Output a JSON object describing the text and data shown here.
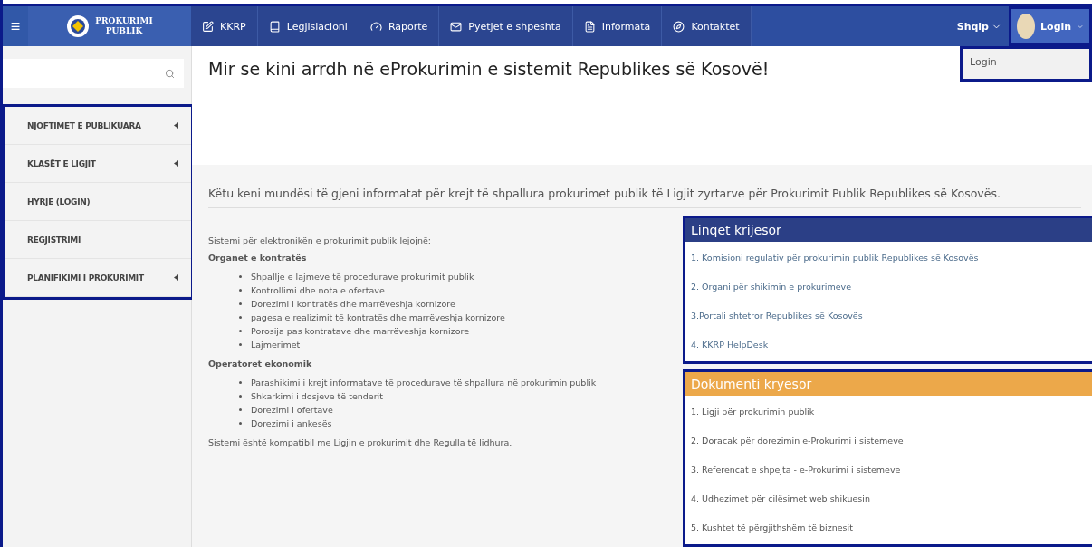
{
  "navbar": {
    "menu_icon": "≡",
    "logo": {
      "line1": "PROKURIMI",
      "line2": "PUBLIK"
    },
    "items": [
      {
        "label": "KKRP"
      },
      {
        "label": "Legjislacioni"
      },
      {
        "label": "Raporte"
      },
      {
        "label": "Pyetjet e shpeshta"
      },
      {
        "label": "Informata"
      },
      {
        "label": "Kontaktet"
      }
    ],
    "language": "Shqip",
    "login": "Login",
    "login_menu": [
      "Login"
    ]
  },
  "sidebar": {
    "items": [
      {
        "label": "NJOFTIMET E PUBLIKUARA",
        "has_submenu": true
      },
      {
        "label": "KLASËT E LIGJIT",
        "has_submenu": true
      },
      {
        "label": "HYRJE (LOGIN)",
        "has_submenu": false
      },
      {
        "label": "REGJISTRIMI",
        "has_submenu": false
      },
      {
        "label": "PLANIFIKIMI I PROKURIMIT",
        "has_submenu": true
      }
    ]
  },
  "main": {
    "title": "Mir se kini arrdh në eProkurimin e sistemit Republikes së Kosovë!",
    "intro": "Këtu keni mundësi të gjeni informatat për krejt të shpallura prokurimet publik të Ligjit zyrtarve për Prokurimit Publik Republikes së Kosovës.",
    "lead": "Sistemi për elektronikën e prokurimit publik lejojnë:",
    "sections": [
      {
        "heading": "Organet e kontratës",
        "items": [
          "Shpallje e lajmeve të procedurave prokurimit publik",
          "Kontrollimi dhe nota e ofertave",
          "Dorezimi i kontratës dhe marrëveshja kornizore",
          "pagesa e realizimit të kontratës dhe marrëveshja kornizore",
          "Porosija pas kontratave dhe marrëveshja kornizore",
          "Lajmerimet"
        ]
      },
      {
        "heading": "Operatoret ekonomik",
        "items": [
          "Parashikimi i krejt informatave të procedurave të shpallura në prokurimin publik",
          "Shkarkimi i dosjeve të tenderit",
          "Dorezimi i ofertave",
          "Dorezimi i ankesës"
        ]
      }
    ],
    "closing": "Sistemi është kompatibil me Ligjin e prokurimit dhe Regulla të lidhura.",
    "panels": [
      {
        "title": "Linqet krijesor",
        "color": "#2b3f86",
        "links": [
          "1. Komisioni regulativ për prokurimin publik Republikes së Kosovës",
          "2. Organi për shikimin e prokurimeve",
          "3.Portali shtetror Republikes së Kosovës",
          "4. KKRP HelpDesk"
        ]
      },
      {
        "title": "Dokumenti kryesor",
        "color": "#eca84a",
        "links": [
          "1. Ligji për prokurimin publik",
          "2. Doracak për dorezimin e-Prokurimi i sistemeve",
          "3. Referencat e shpejta - e-Prokurimi i sistemeve",
          "4. Udhezimet për cilësimet web shikuesin",
          "5. Kushtet të përgjithshëm të biznesit"
        ]
      }
    ]
  }
}
